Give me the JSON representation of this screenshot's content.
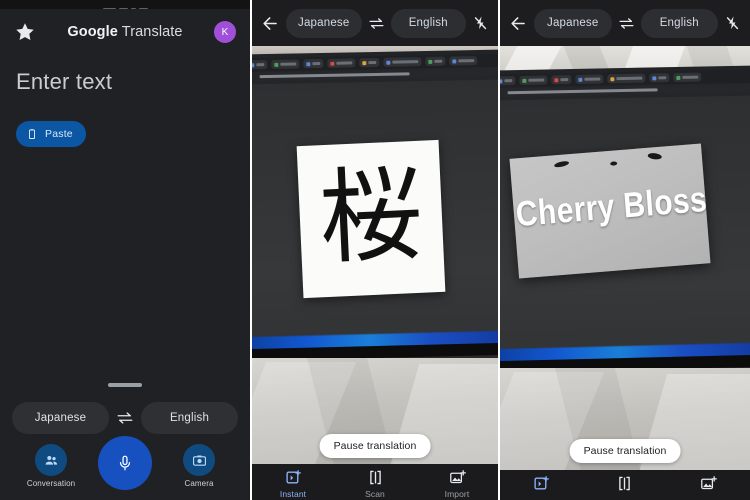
{
  "panels": {
    "home": {
      "name": "google-translate-home",
      "app_title_brand": "Google",
      "app_title_sub": "Translate",
      "star_icon": "star-icon",
      "avatar_initial": "K",
      "compose_placeholder": "Enter text",
      "paste_label": "Paste",
      "paste_icon": "clipboard-icon",
      "source_language": "Japanese",
      "target_language": "English",
      "swap_icon": "swap-languages-icon",
      "actions": [
        {
          "label": "Conversation",
          "icon": "conversation-icon"
        },
        {
          "label": "",
          "icon": "microphone-icon"
        },
        {
          "label": "Camera",
          "icon": "camera-icon"
        }
      ]
    },
    "camera_scan": {
      "name": "camera-translate-scanning",
      "back_icon": "back-arrow-icon",
      "source_language": "Japanese",
      "target_language": "English",
      "swap_icon": "swap-languages-icon",
      "flash_icon": "flash-off-icon",
      "detected_text": "桜",
      "pause_label": "Pause translation",
      "tabs": [
        {
          "label": "Instant",
          "icon": "instant-translate-icon",
          "active": true
        },
        {
          "label": "Scan",
          "icon": "scan-icon",
          "active": false
        },
        {
          "label": "Import",
          "icon": "import-image-icon",
          "active": false
        }
      ]
    },
    "camera_translated": {
      "name": "camera-translate-result",
      "back_icon": "back-arrow-icon",
      "source_language": "Japanese",
      "target_language": "English",
      "swap_icon": "swap-languages-icon",
      "flash_icon": "flash-off-icon",
      "translated_text": "Cherry Blossoms",
      "pause_label": "Pause translation",
      "tabs": [
        {
          "label": "",
          "icon": "instant-translate-icon",
          "active": true
        },
        {
          "label": "",
          "icon": "scan-icon",
          "active": false
        },
        {
          "label": "",
          "icon": "import-image-icon",
          "active": false
        }
      ]
    }
  },
  "colors": {
    "app_background": "#202124",
    "accent_blue": "#1651bf",
    "paste_blue": "#0b57a4",
    "chip_blue_text": "#8ab4f8",
    "avatar_purple": "#a050d8",
    "pill_white": "#ffffff"
  }
}
